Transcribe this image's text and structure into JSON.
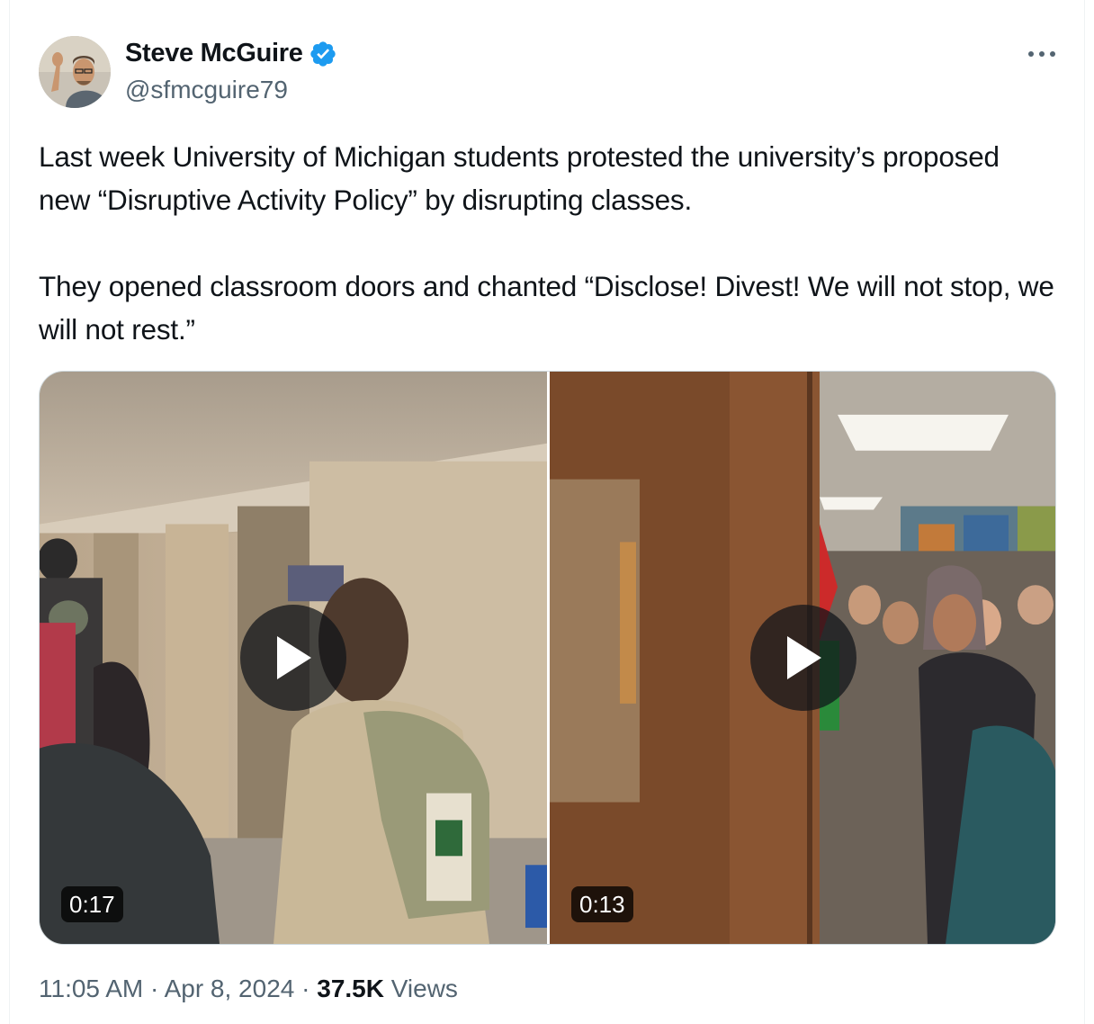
{
  "author": {
    "display_name": "Steve McGuire",
    "handle": "@sfmcguire79",
    "verified_icon": "verified-badge-icon",
    "avatar_icon": "avatar"
  },
  "menu": {
    "more_icon": "more-options-icon"
  },
  "tweet": {
    "text": "Last week University of Michigan students protested the university’s proposed new “Disruptive Activity Policy” by disrupting classes.\n\nThey opened classroom doors and chanted “Disclose! Divest! We will not stop, we will not rest.”"
  },
  "media": [
    {
      "type": "video",
      "duration": "0:17",
      "play_icon": "play-icon"
    },
    {
      "type": "video",
      "duration": "0:13",
      "play_icon": "play-icon"
    }
  ],
  "meta": {
    "time": "11:05 AM",
    "separator": "·",
    "date": "Apr 8, 2024",
    "views_count": "37.5K",
    "views_label": "Views"
  },
  "colors": {
    "text_primary": "#0f1419",
    "text_secondary": "#536471",
    "verified_blue": "#1d9bf0",
    "border": "#cfd9de"
  }
}
